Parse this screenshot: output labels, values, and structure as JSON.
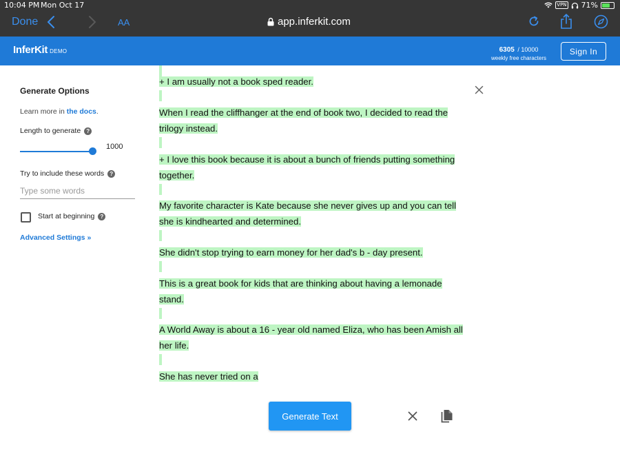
{
  "status_bar": {
    "time": "10:04 PM",
    "date": "Mon Oct 17",
    "vpn": "VPN",
    "battery": "71%",
    "battery_level": 0.71
  },
  "browser": {
    "done_label": "Done",
    "aa_label": "AA",
    "url": "app.inferkit.com",
    "accent": "#3a8fef"
  },
  "app": {
    "brand": "InferKit",
    "brand_tag": "DEMO",
    "credits_used": "6305",
    "credits_total": "/ 10000",
    "credits_caption": "weekly free characters",
    "signin_label": "Sign In",
    "brand_color": "#1f7ad7"
  },
  "sidebar": {
    "title": "Generate Options",
    "learn_prefix": "Learn more in",
    "learn_link": "the docs",
    "learn_suffix": ".",
    "length_label": "Length to generate",
    "length_value": "1000",
    "length_fraction": 1.0,
    "include_label": "Try to include these words",
    "include_placeholder": "Type some words",
    "include_value": "",
    "start_label": "Start at beginning",
    "start_checked": false,
    "advanced_label": "Advanced Settings »"
  },
  "editor": {
    "highlight_color": "#bef5c3",
    "paragraphs": [
      "+ I am usually not a book sped reader.",
      "When I read the cliffhanger at the end of book two, I decided to read the trilogy instead.",
      "+ I love this book because it is about a bunch of friends putting something together.",
      "My favorite character is Kate because she never gives up and you can tell she is kindhearted and determined.",
      "She didn't stop trying to earn money for her dad's b - day present.",
      "This is a great book for kids that are thinking about having a lemonade stand.",
      "A World Away is about a 16 - year old named Eliza, who has been Amish all her life.",
      "She has never tried on a"
    ]
  },
  "controls": {
    "generate_label": "Generate Text",
    "generate_color": "#2196f3"
  }
}
